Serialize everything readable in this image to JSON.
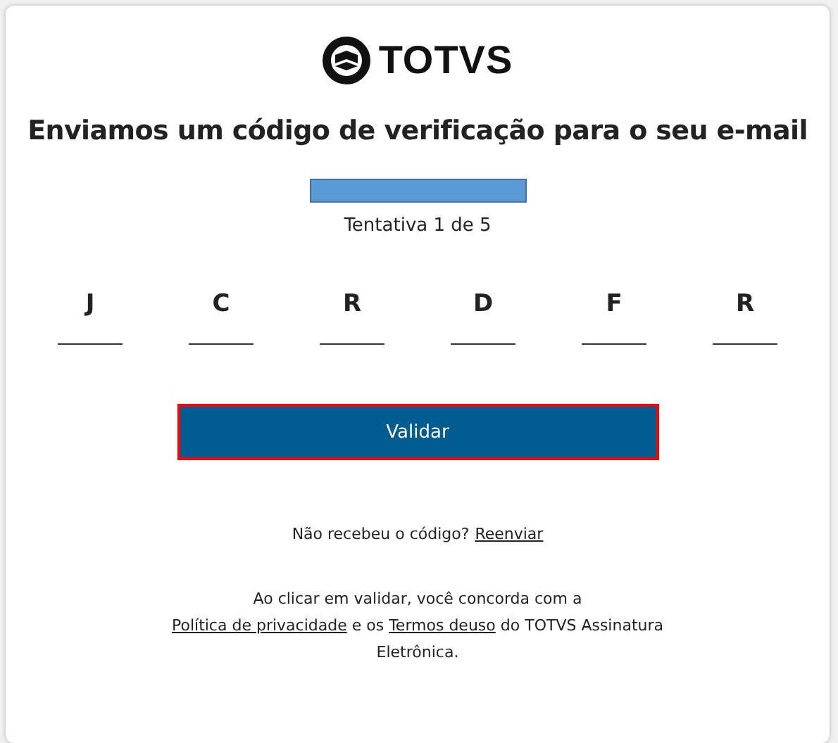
{
  "logo": {
    "text": "TOTVS"
  },
  "heading": "Enviamos um código de verificação para o seu e-mail",
  "attempt": "Tentativa 1 de 5",
  "code": [
    "J",
    "C",
    "R",
    "D",
    "F",
    "R"
  ],
  "validate_button": {
    "label": "Validar",
    "focused": true
  },
  "resend": {
    "text": "Não recebeu o código?",
    "link": "Reenviar"
  },
  "footer": [
    {
      "kind": "text",
      "text": "Ao clicar em validar, você concorda com a "
    },
    {
      "kind": "link",
      "text": "Política de privacidade"
    },
    {
      "kind": "text",
      "text": " e os "
    },
    {
      "kind": "link",
      "text": "Termos deuso"
    },
    {
      "kind": "text",
      "text": " do TOTVS Assinatura Eletrônica."
    }
  ]
}
